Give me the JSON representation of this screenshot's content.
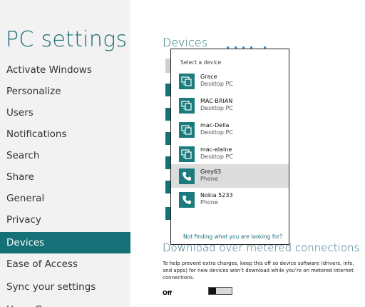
{
  "nav": {
    "title": "PC settings",
    "items": [
      {
        "label": "Activate Windows"
      },
      {
        "label": "Personalize"
      },
      {
        "label": "Users"
      },
      {
        "label": "Notifications"
      },
      {
        "label": "Search"
      },
      {
        "label": "Share"
      },
      {
        "label": "General"
      },
      {
        "label": "Privacy"
      },
      {
        "label": "Devices"
      },
      {
        "label": "Ease of Access"
      },
      {
        "label": "Sync your settings"
      },
      {
        "label": "HomeGroup"
      }
    ],
    "selected": "Devices"
  },
  "content": {
    "title": "Devices",
    "metered": {
      "heading": "Download over metered connections",
      "description": "To help prevent extra charges, keep this off so device software (drivers, info, and apps) for new devices won’t download while you’re on metered Internet connections.",
      "toggle_state": "Off"
    }
  },
  "flyout": {
    "header": "Select a device",
    "devices": [
      {
        "name": "Grace",
        "type": "Desktop PC",
        "icon": "desktop-pc-icon"
      },
      {
        "name": "MAC-BRIAN",
        "type": "Desktop PC",
        "icon": "desktop-pc-icon"
      },
      {
        "name": "mac-Della",
        "type": "Desktop PC",
        "icon": "desktop-pc-icon"
      },
      {
        "name": "mac-elaine",
        "type": "Desktop PC",
        "icon": "desktop-pc-icon"
      },
      {
        "name": "Grey63",
        "type": "Phone",
        "icon": "phone-icon"
      },
      {
        "name": "Nokia 5233",
        "type": "Phone",
        "icon": "phone-icon"
      }
    ],
    "selected_device": "Grey63",
    "link": "Not finding what you are looking for?"
  },
  "colors": {
    "accent": "#157177",
    "nav_background": "#f2f2f2",
    "selected_row": "#dcdcdc"
  }
}
